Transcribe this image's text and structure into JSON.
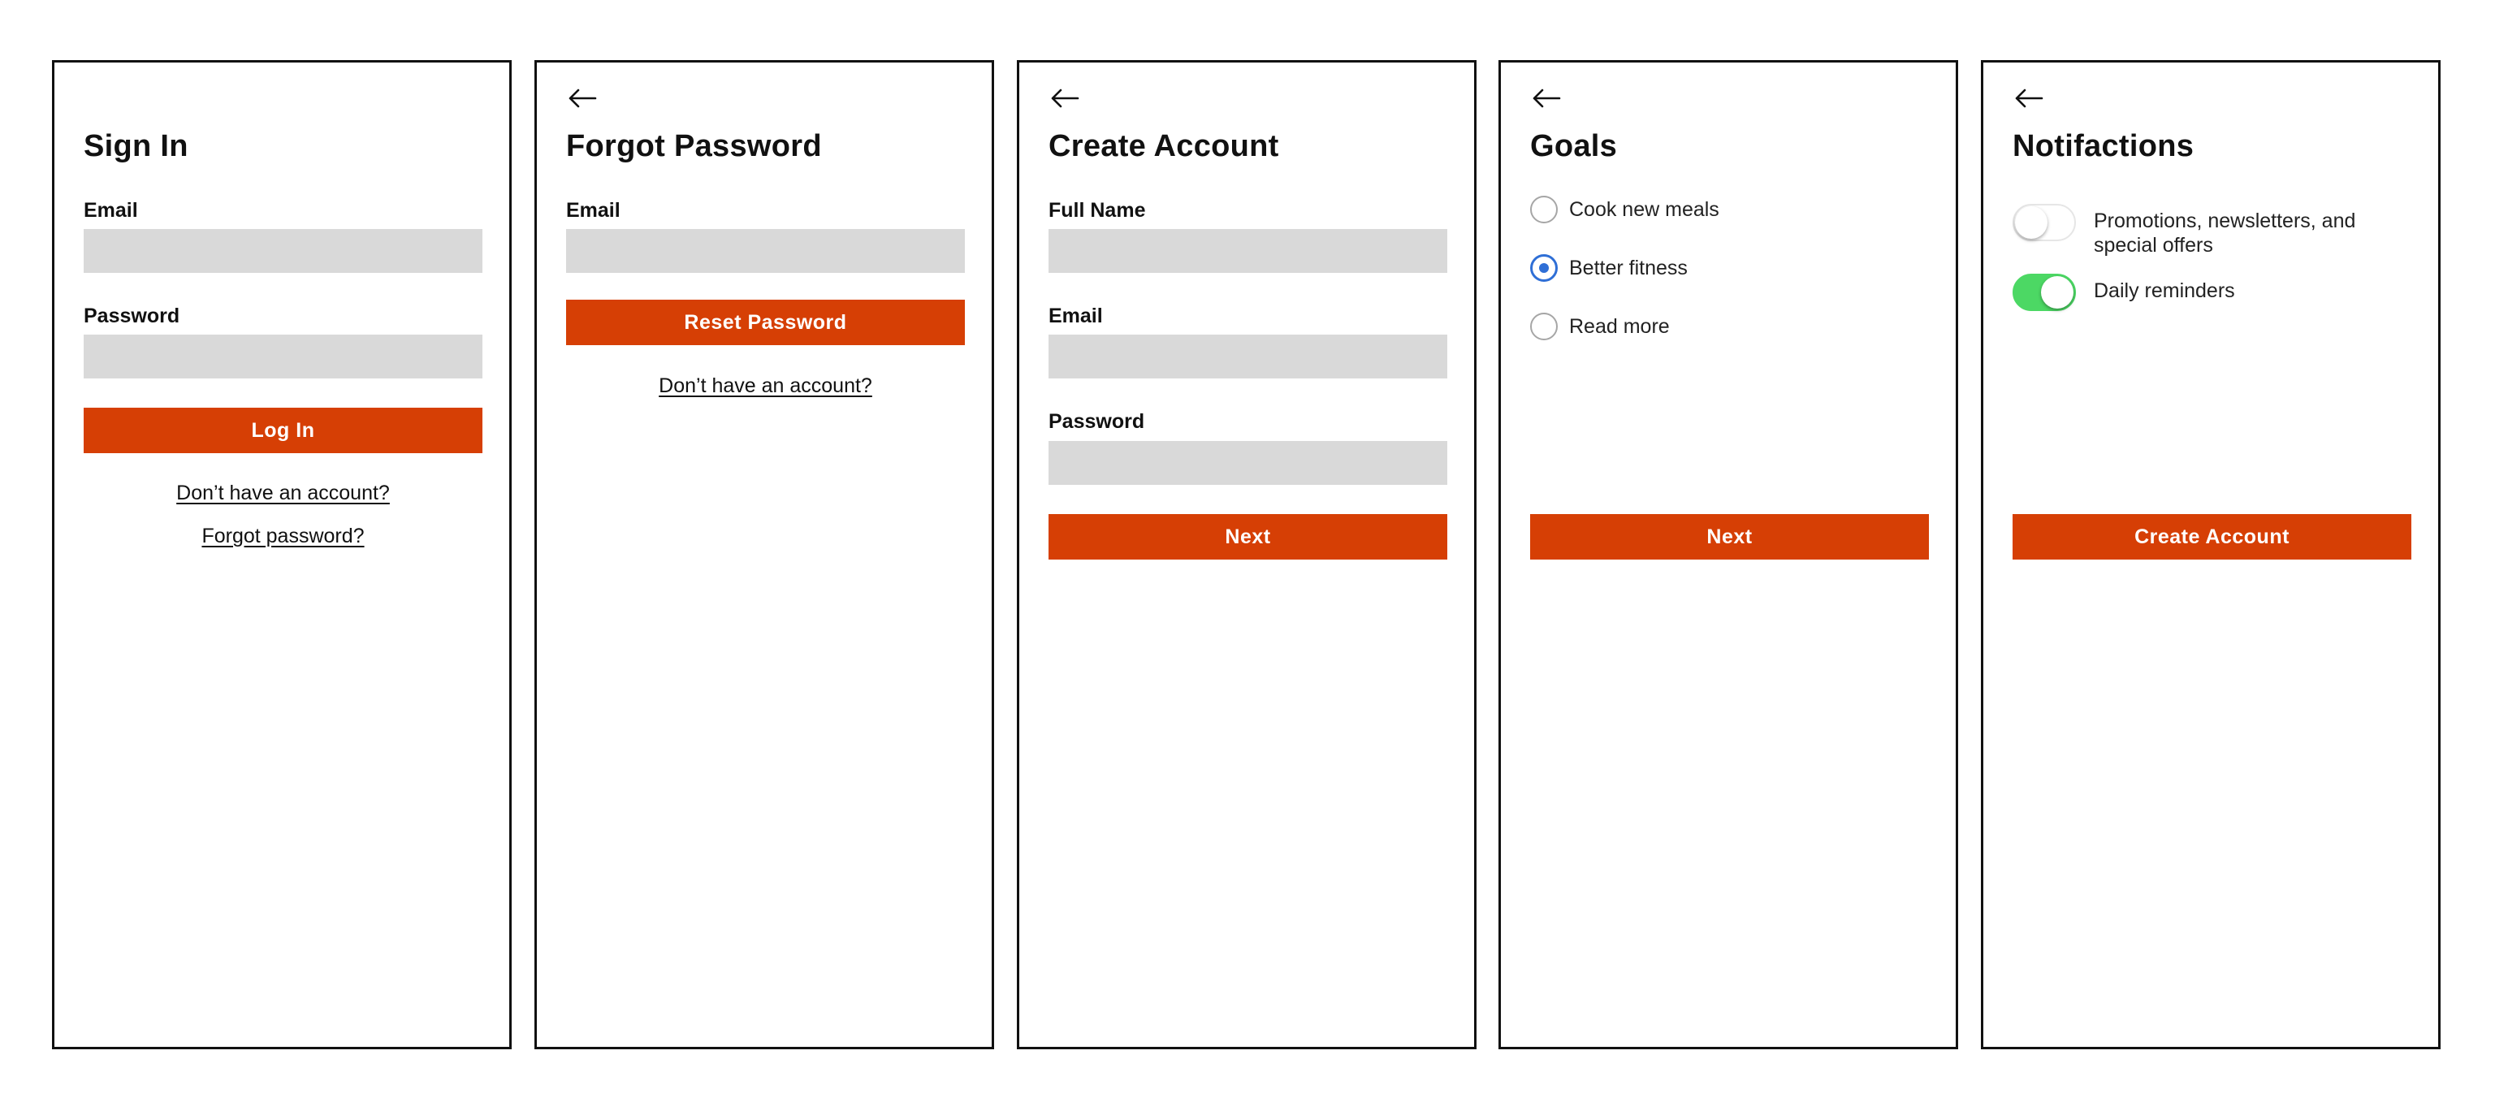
{
  "screens": {
    "signin": {
      "title": "Sign In",
      "email_label": "Email",
      "email_value": "",
      "password_label": "Password",
      "password_value": "",
      "login_button": "Log In",
      "no_account_link": "Don’t have an account?",
      "forgot_link": "Forgot password?"
    },
    "forgot": {
      "title": "Forgot Password",
      "email_label": "Email",
      "email_value": "",
      "reset_button": "Reset Password",
      "no_account_link": "Don’t have an account?"
    },
    "create": {
      "title": "Create Account",
      "fullname_label": "Full Name",
      "fullname_value": "",
      "email_label": "Email",
      "email_value": "",
      "password_label": "Password",
      "password_value": "",
      "next_button": "Next"
    },
    "goals": {
      "title": "Goals",
      "options": [
        {
          "label": "Cook new meals",
          "selected": false
        },
        {
          "label": "Better fitness",
          "selected": true
        },
        {
          "label": "Read more",
          "selected": false
        }
      ],
      "next_button": "Next"
    },
    "notifications": {
      "title": "Notifactions",
      "toggles": [
        {
          "label": "Promotions, newsletters, and special offers",
          "on": false
        },
        {
          "label": "Daily reminders",
          "on": true
        }
      ],
      "create_button": "Create Account"
    }
  },
  "icons": {
    "back": "arrow-left-icon"
  },
  "colors": {
    "accent": "#d63f05",
    "input_bg": "#d9d9d9",
    "radio_selected": "#2f6fd6",
    "toggle_on": "#4cd864",
    "border": "#111111"
  }
}
